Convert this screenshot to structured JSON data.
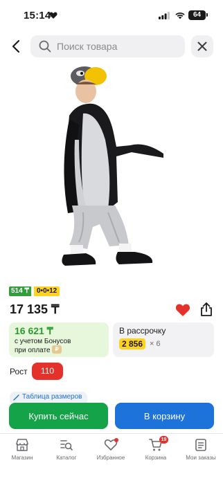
{
  "status": {
    "time": "15:14",
    "battery": "64"
  },
  "search": {
    "placeholder": "Поиск товара"
  },
  "product": {
    "badge_left": "514 ₸",
    "badge_right": "0•0•12",
    "price": "17 135 ₸"
  },
  "bonus": {
    "price": "16 621 ₸",
    "line1": "с учетом Бонусов",
    "line2": "при оплате",
    "chip": "₽"
  },
  "installment": {
    "title": "В рассрочку",
    "amount": "2 856",
    "count": "× 6"
  },
  "size": {
    "label": "Рост",
    "value": "110"
  },
  "size_table": {
    "label": "Таблица размеров"
  },
  "actions": {
    "buy": "Купить сейчас",
    "cart": "В корзину"
  },
  "tabs": [
    {
      "label": "Магазин",
      "icon": "shop-icon"
    },
    {
      "label": "Каталог",
      "icon": "catalog-icon"
    },
    {
      "label": "Избранное",
      "icon": "heart-icon"
    },
    {
      "label": "Корзина",
      "icon": "cart-icon",
      "badge": "19"
    },
    {
      "label": "Мои заказы",
      "icon": "orders-icon"
    }
  ],
  "colors": {
    "accent_green": "#15a34a",
    "accent_blue": "#1d73d9",
    "accent_red": "#e4312b",
    "bonus_bg": "#e7f7dc",
    "yellow": "#ffd21f"
  }
}
